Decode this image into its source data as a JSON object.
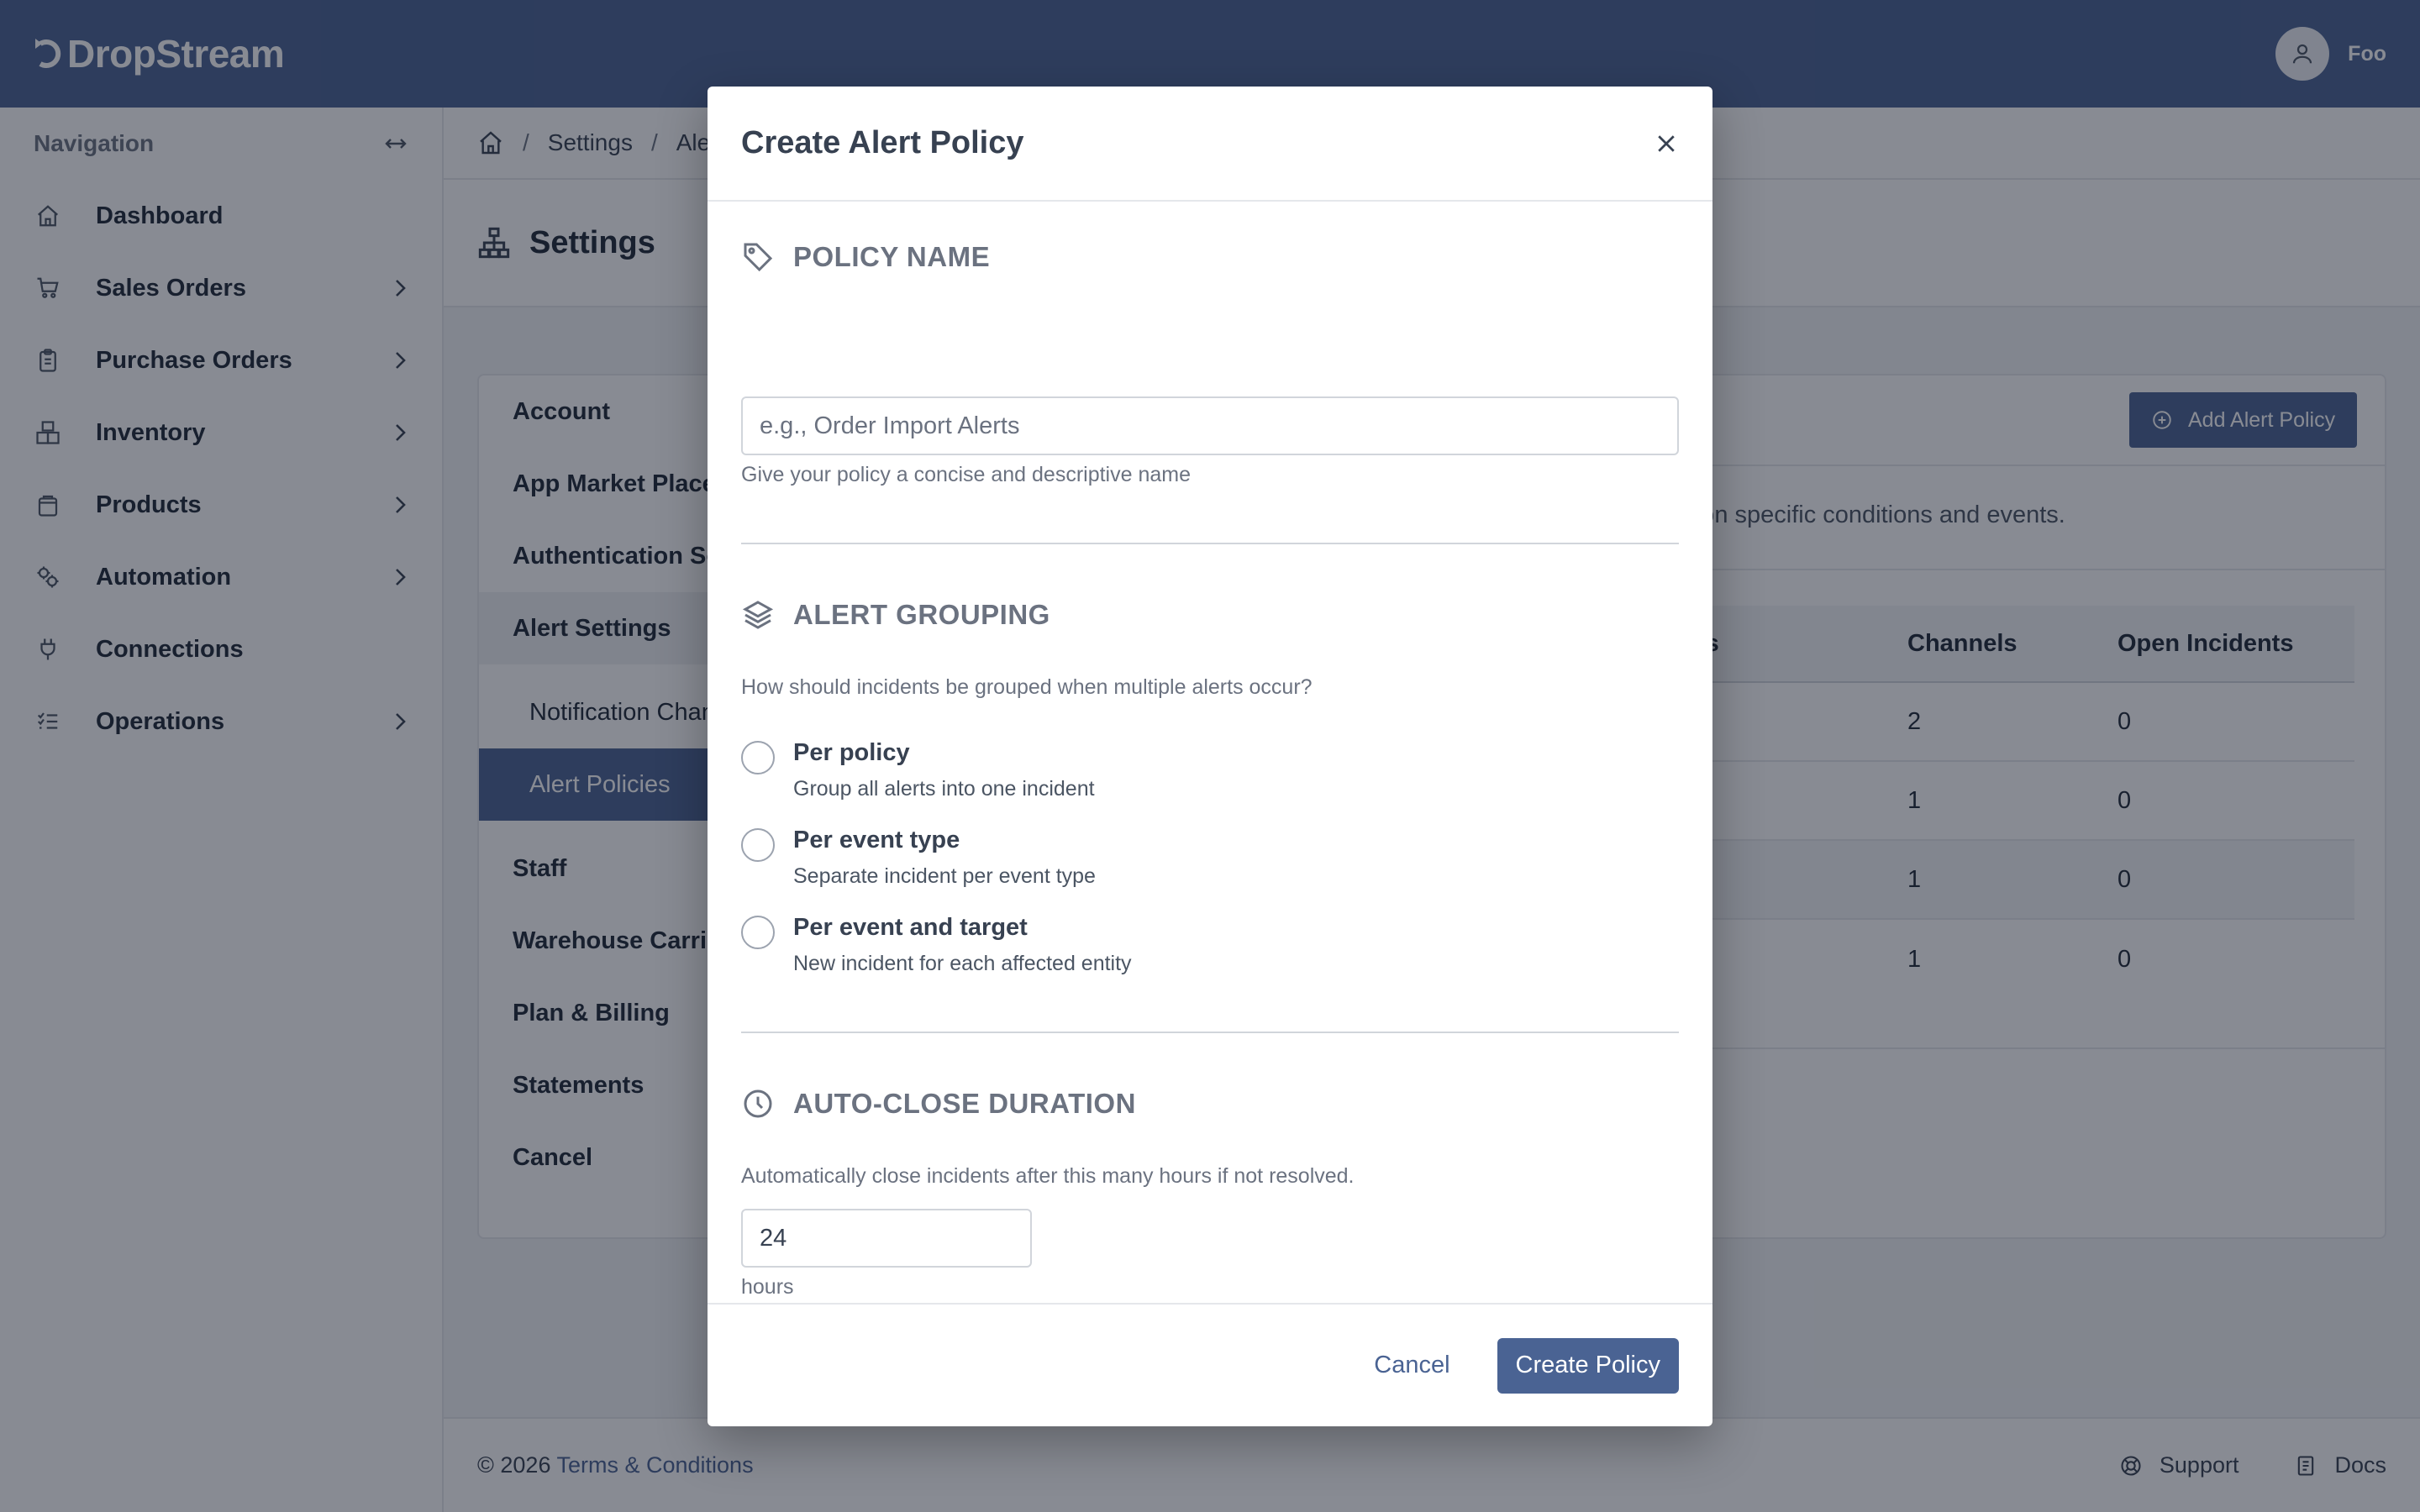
{
  "app": {
    "logo_text": "DropStream",
    "user_name": "Foo"
  },
  "sidebar": {
    "header": "Navigation",
    "items": [
      {
        "label": "Dashboard",
        "icon": "home-icon",
        "has_children": false
      },
      {
        "label": "Sales Orders",
        "icon": "cart-icon",
        "has_children": true
      },
      {
        "label": "Purchase Orders",
        "icon": "clipboard-icon",
        "has_children": true
      },
      {
        "label": "Inventory",
        "icon": "boxes-icon",
        "has_children": true
      },
      {
        "label": "Products",
        "icon": "bag-icon",
        "has_children": true
      },
      {
        "label": "Automation",
        "icon": "gears-icon",
        "has_children": true
      },
      {
        "label": "Connections",
        "icon": "plug-icon",
        "has_children": false
      },
      {
        "label": "Operations",
        "icon": "list-icon",
        "has_children": true
      }
    ]
  },
  "breadcrumb": {
    "items": [
      "Settings",
      "Aler"
    ]
  },
  "page": {
    "title": "Settings"
  },
  "settings_nav": {
    "items": [
      "Account",
      "App Market Place",
      "Authentication So",
      "Alert Settings"
    ],
    "children": [
      "Notification Chan",
      "Alert Policies"
    ],
    "items_after": [
      "Staff",
      "Warehouse Carrie",
      "Plan & Billing",
      "Statements",
      "Cancel"
    ]
  },
  "alert_policies": {
    "add_button": "Add Alert Policy",
    "description": "d on specific conditions and events.",
    "columns": [
      "vents",
      "Channels",
      "Open Incidents"
    ],
    "rows": [
      {
        "events": "",
        "channels": "2",
        "open": "0"
      },
      {
        "events": "",
        "channels": "1",
        "open": "0"
      },
      {
        "events": "",
        "channels": "1",
        "open": "0"
      },
      {
        "events": "",
        "channels": "1",
        "open": "0"
      }
    ]
  },
  "footer": {
    "copyright": "© 2026",
    "terms": "Terms & Conditions",
    "support": "Support",
    "docs": "Docs"
  },
  "modal": {
    "title": "Create Alert Policy",
    "policy_name": {
      "heading": "POLICY NAME",
      "placeholder": "e.g., Order Import Alerts",
      "help": "Give your policy a concise and descriptive name"
    },
    "grouping": {
      "heading": "ALERT GROUPING",
      "question": "How should incidents be grouped when multiple alerts occur?",
      "options": [
        {
          "title": "Per policy",
          "desc": "Group all alerts into one incident"
        },
        {
          "title": "Per event type",
          "desc": "Separate incident per event type"
        },
        {
          "title": "Per event and target",
          "desc": "New incident for each affected entity"
        }
      ]
    },
    "auto_close": {
      "heading": "AUTO-CLOSE DURATION",
      "help": "Automatically close incidents after this many hours if not resolved.",
      "value": "24",
      "unit": "hours"
    },
    "cancel_label": "Cancel",
    "create_label": "Create Policy"
  }
}
